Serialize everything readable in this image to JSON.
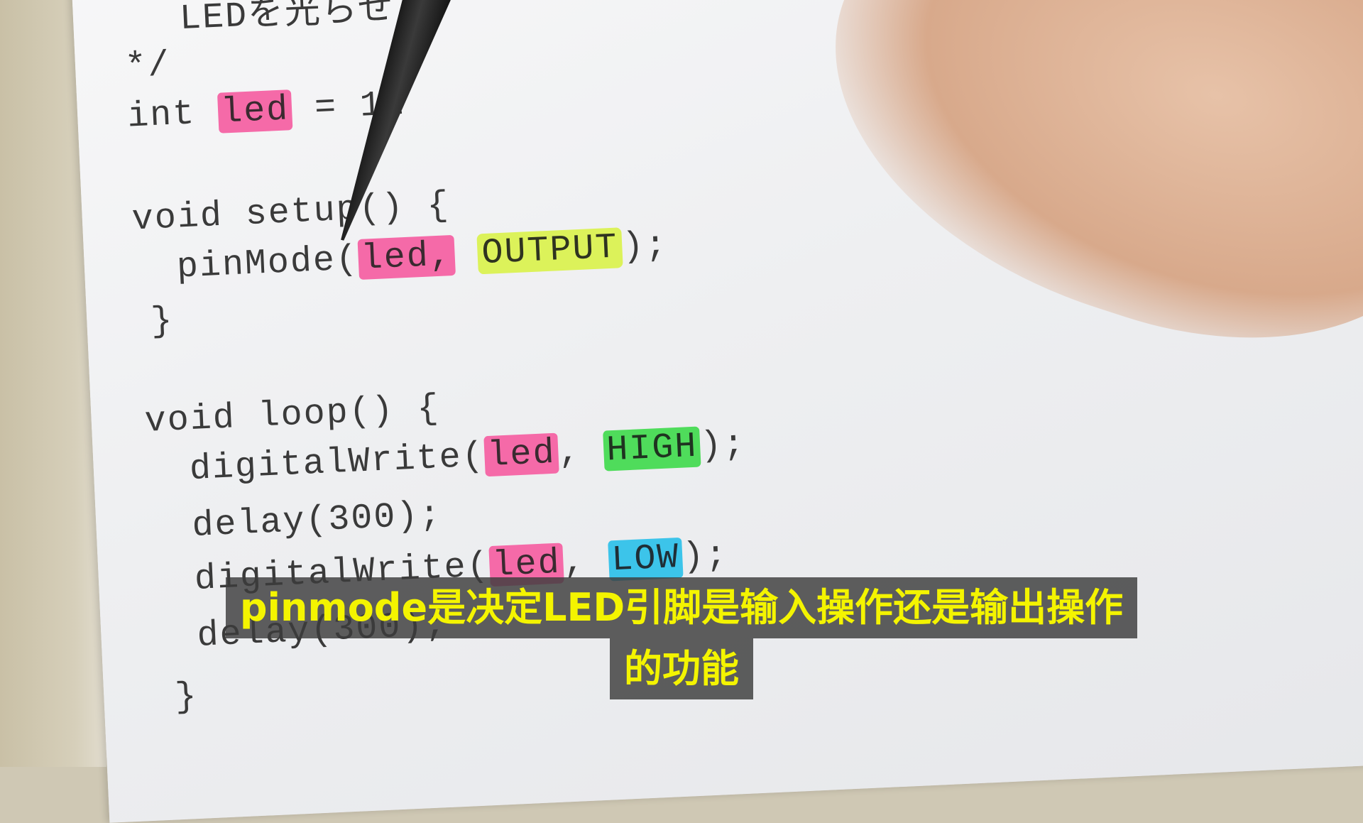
{
  "code": {
    "header_fragment": "LEDを光らせ",
    "comment_end": "*/",
    "int_kw": "int",
    "led_var": "led",
    "int_assign": " = 12",
    "void_setup": "void setup() {",
    "pinmode_fn": "pinMode(",
    "output_kw": "OUTPUT",
    "pinmode_end": ");",
    "close_brace": "}",
    "void_loop": "void loop() {",
    "digitalwrite_fn": "digitalWrite(",
    "comma": ", ",
    "high_kw": "HIGH",
    "stmt_end": ");",
    "delay_stmt": "delay(300);",
    "digitalwrite_partial": "digitalWrite(",
    "low_kw": "LOW"
  },
  "subtitle": {
    "line1": "pinmode是决定LED引脚是输入操作还是输出操作",
    "line2": "的功能"
  },
  "colors": {
    "highlight_pink": "#f56aa8",
    "highlight_yellow": "#dcf25a",
    "highlight_green": "#4fdc5b",
    "highlight_blue": "#3cc4ea",
    "subtitle_text": "#f4f400"
  }
}
